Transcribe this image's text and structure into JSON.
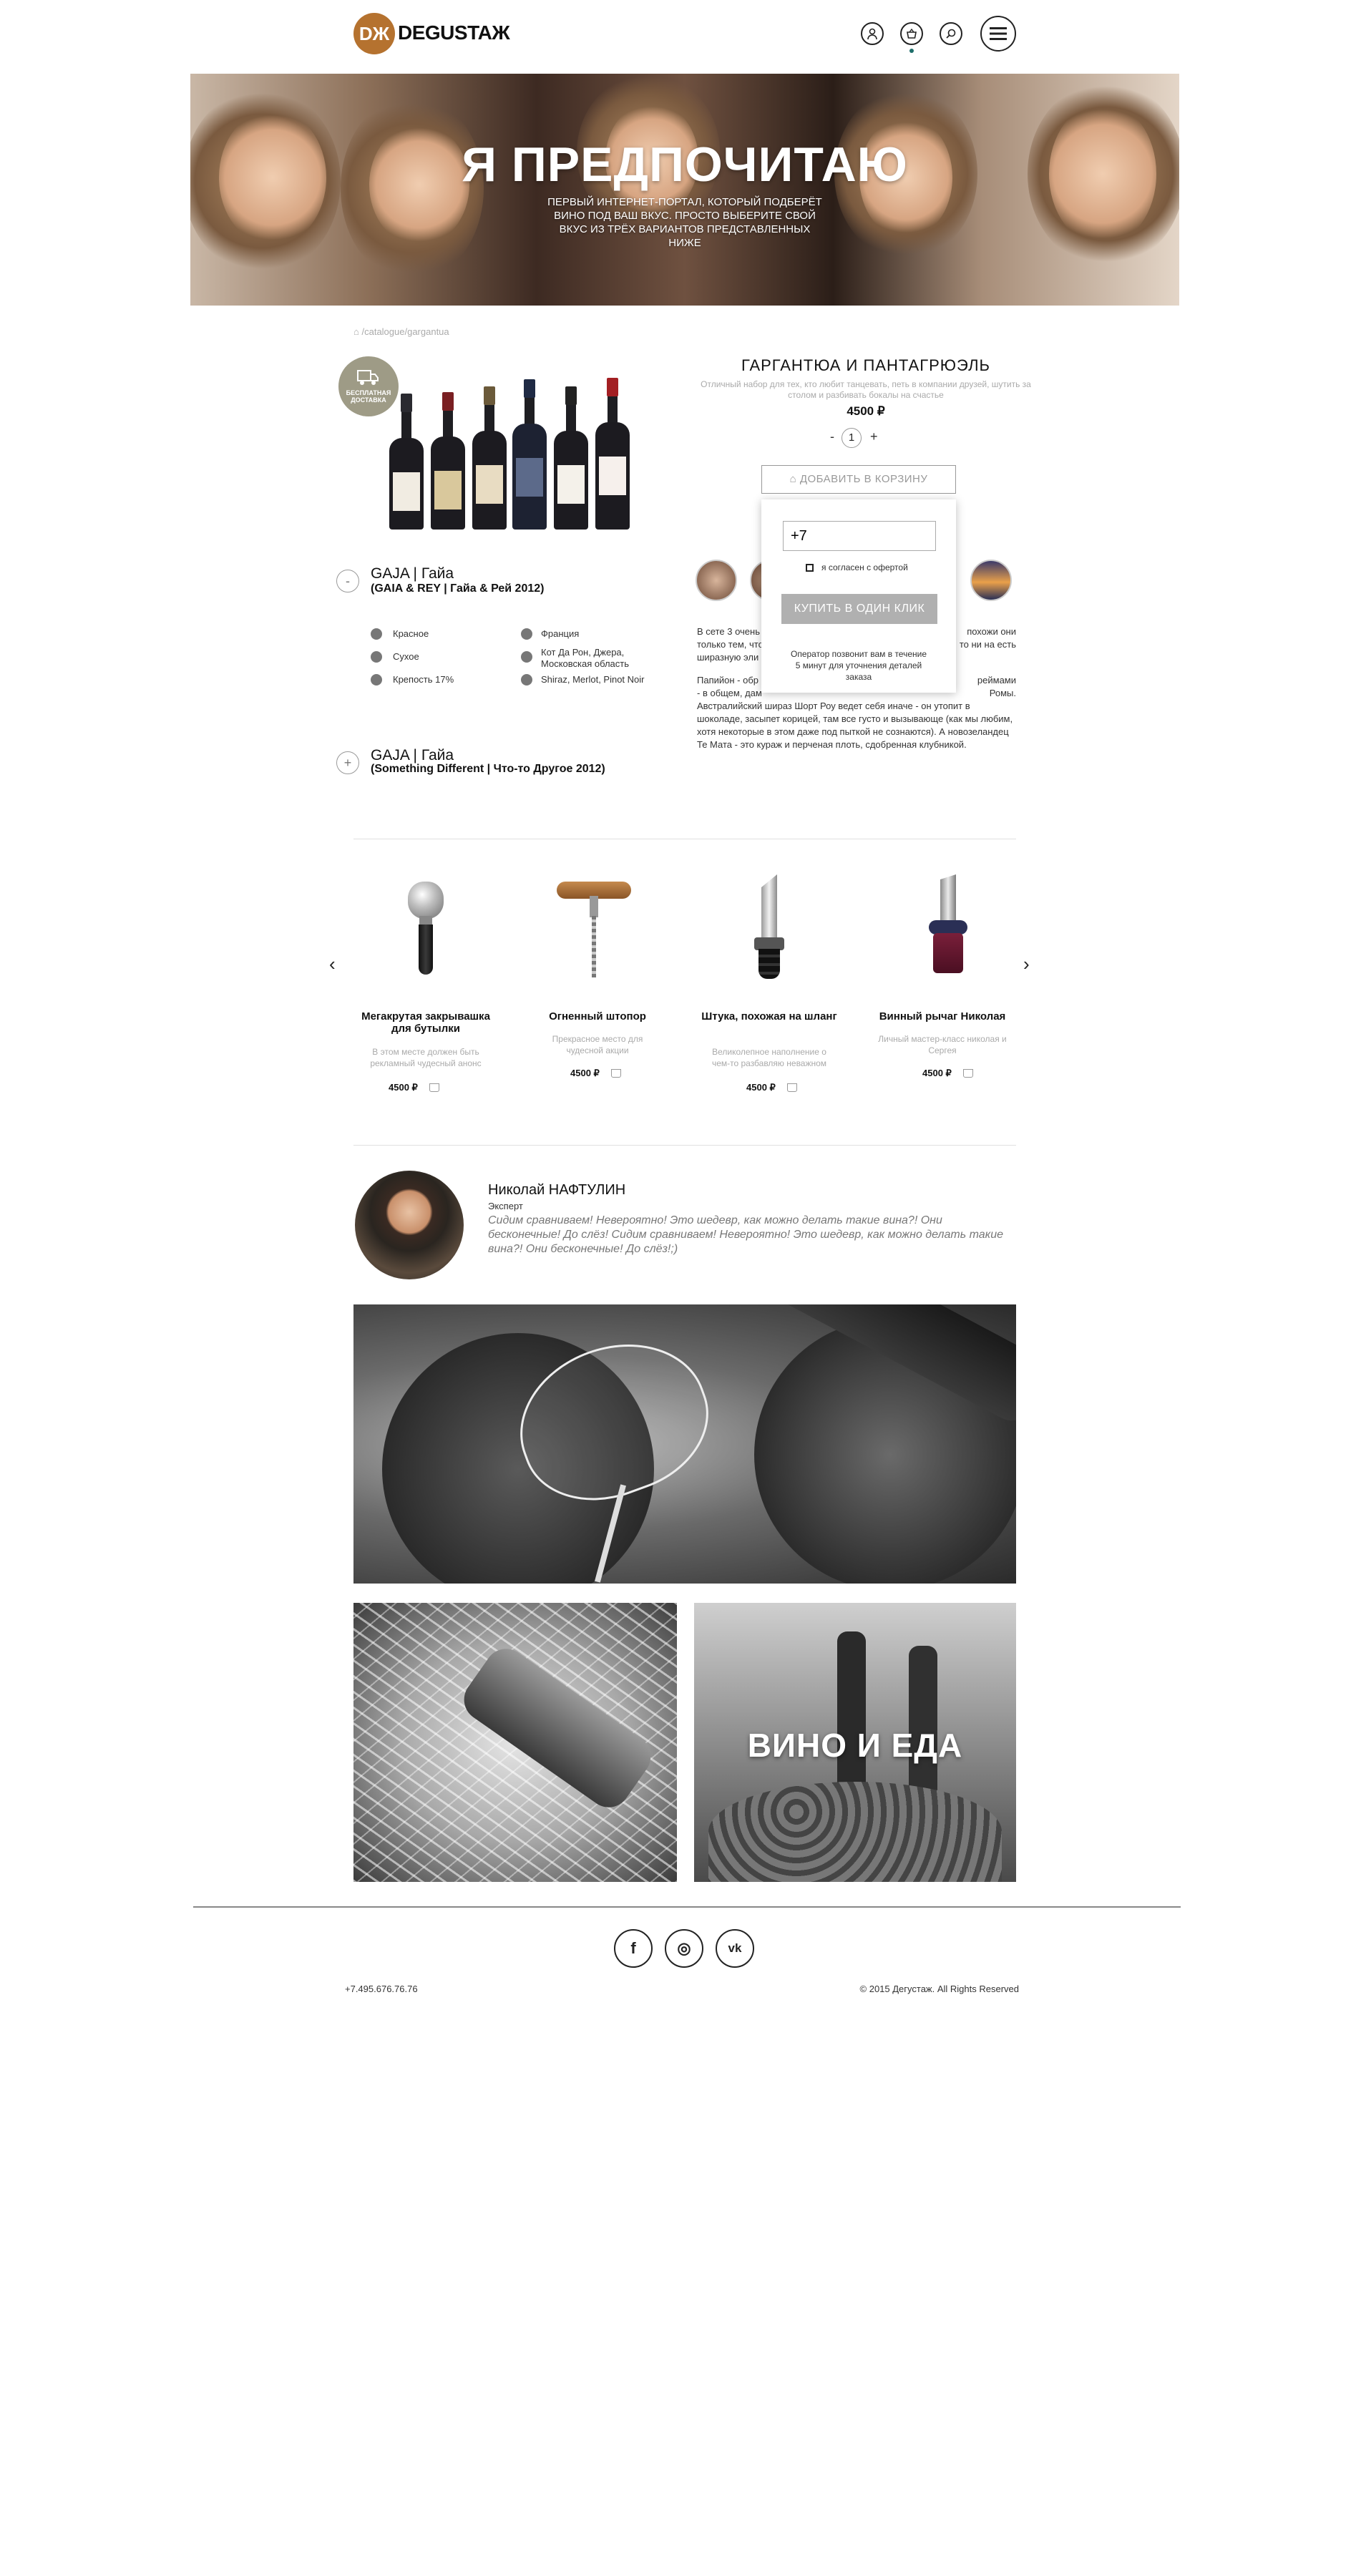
{
  "header": {
    "logo_badge": "DЖ",
    "logo_text": "DEGUSTAЖ",
    "icons": [
      "user-icon",
      "basket-icon",
      "search-icon",
      "menu-icon"
    ]
  },
  "hero": {
    "title": "Я ПРЕДПОЧИТАЮ",
    "subtitle": "ПЕРВЫЙ ИНТЕРНЕТ-ПОРТАЛ, КОТОРЫЙ ПОДБЕРЁТ ВИНО ПОД ВАШ ВКУС. ПРОСТО ВЫБЕРИТЕ СВОЙ ВКУС ИЗ ТРЁХ ВАРИАНТОВ ПРЕДСТАВЛЕННЫХ НИЖЕ"
  },
  "breadcrumb": "/catalogue/gargantua",
  "product": {
    "badge": "БЕСПЛАТНАЯ ДОСТАВКА",
    "title": "ГАРГАНТЮА И ПАНТАГРЮЭЛЬ",
    "description": "Отличный набор для тех, кто любит танцевать, петь в компании друзей, шутить за столом и разбивать бокалы на счастье",
    "price": "4500 ₽",
    "qty_minus": "-",
    "qty": "1",
    "qty_plus": "+",
    "add_to_cart": "ДОБАВИТЬ В КОРЗИНУ"
  },
  "popup": {
    "phone_value": "+7",
    "agree": "я согласен с офертой",
    "buy_one_click": "КУПИТЬ В ОДИН КЛИК",
    "note": "Оператор позвонит вам в течение 5 минут для уточнения деталей заказа"
  },
  "variants": [
    {
      "toggle": "-",
      "name": "GAJA | Гайа",
      "sub": "(GAIA & REY | Гайа & Рей 2012)",
      "attrs_left": [
        "Красное",
        "Сухое",
        "Крепость 17%"
      ],
      "attrs_right": [
        "Франция",
        "Кот Да Рон, Джера, Московская область",
        "Shiraz, Merlot, Pinot Noir"
      ]
    },
    {
      "toggle": "+",
      "name": "GAJA | Гайа",
      "sub": "(Something Different | Что-то Другое  2012)"
    }
  ],
  "description_text": {
    "p1_left": "В сете 3 очень",
    "p1_right": "похожи они",
    "p1_l2_left": "только тем, что",
    "p1_l2_right": "то ни на есть",
    "p1_l3_left": "ширазную эли",
    "p2": "Папийон - обр",
    "p2_right": "реймами",
    "p2_l2": "- в общем, дам",
    "p2_l2_right": "Ромы.",
    "p3": "Австралийский шираз Шорт Роу ведет себя иначе - он утопит в шоколаде, засыпет корицей, там все густо и вызывающе (как мы любим, хотя некоторые в этом даже под пыткой не сознаются). А новозеландец Те Мата - это кураж и перченая плоть, сдобренная клубникой."
  },
  "accessories": {
    "prev": "‹",
    "next": "›",
    "items": [
      {
        "name": "Мегакрутая закрывашка для бутылки",
        "desc": "В этом месте должен быть рекламный чудесный анонс",
        "price": "4500 ₽"
      },
      {
        "name": "Огненный штопор",
        "desc": "Прекрасное место для чудесной акции",
        "price": "4500 ₽"
      },
      {
        "name": "Штука, похожая на шланг",
        "desc": "Великолепное наполнение о чем-то разбавляю неважном",
        "price": "4500 ₽"
      },
      {
        "name": "Винный рычаг Николая",
        "desc": "Личный мастер-класс николая и Сергея",
        "price": "4500 ₽"
      }
    ]
  },
  "expert": {
    "name": "Николай НАФТУЛИН",
    "role": "Эксперт",
    "quote": "Сидим сравниваем! Невероятно! Это шедевр, как можно делать такие вина?! Они бесконечные! До слёз! Сидим сравниваем! Невероятно! Это шедевр, как можно делать такие вина?! Они бесконечные! До слёз!;)"
  },
  "gallery": {
    "food_title": "ВИНО И ЕДА"
  },
  "footer": {
    "social": [
      "f",
      "◎",
      "vk"
    ],
    "phone": "+7.495.676.76.76",
    "copyright": "© 2015 Дегустаж. All Rights Reserved"
  }
}
